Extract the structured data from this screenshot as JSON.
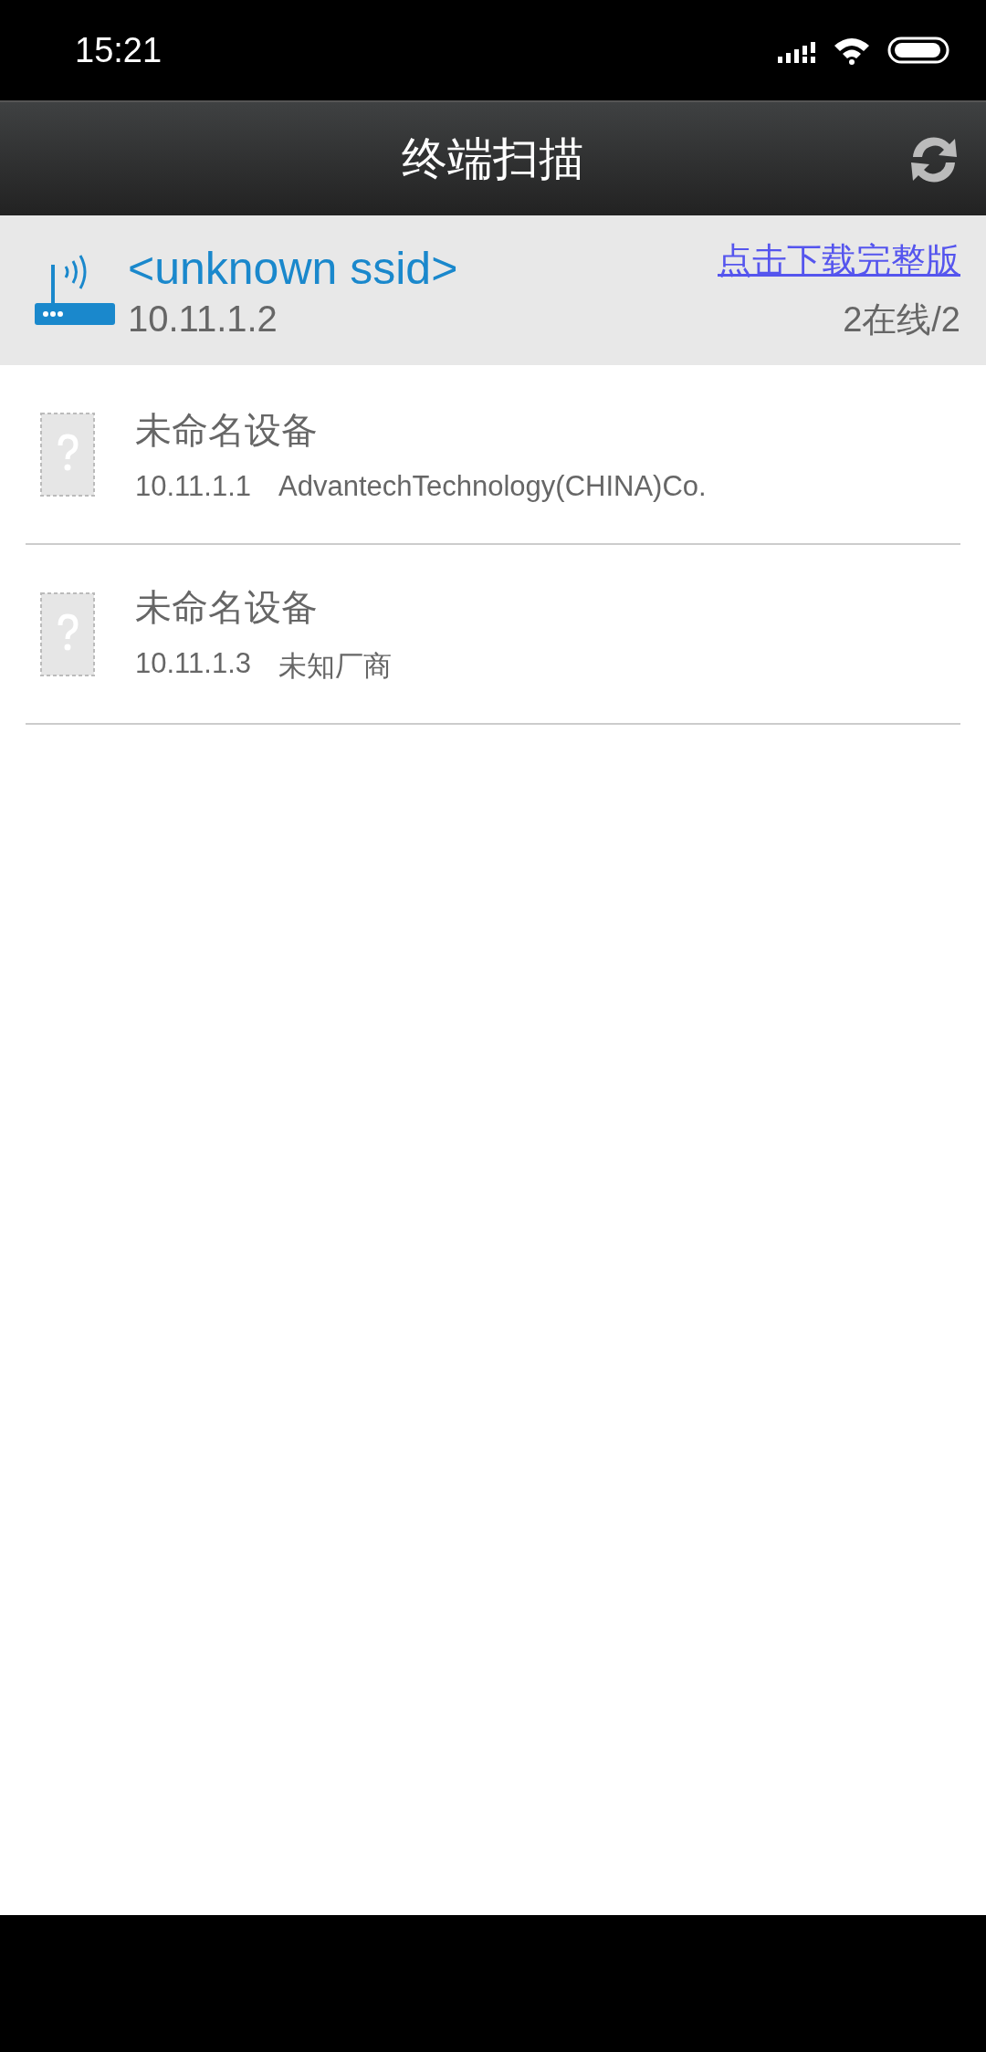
{
  "status_bar": {
    "time": "15:21"
  },
  "header": {
    "title": "终端扫描"
  },
  "network": {
    "ssid": "<unknown ssid>",
    "ip": "10.11.1.2",
    "download_link": "点击下载完整版",
    "online_count": "2在线/2"
  },
  "devices": [
    {
      "name": "未命名设备",
      "ip": "10.11.1.1",
      "vendor": "AdvantechTechnology(CHINA)Co."
    },
    {
      "name": "未命名设备",
      "ip": "10.11.1.3",
      "vendor": "未知厂商"
    }
  ]
}
